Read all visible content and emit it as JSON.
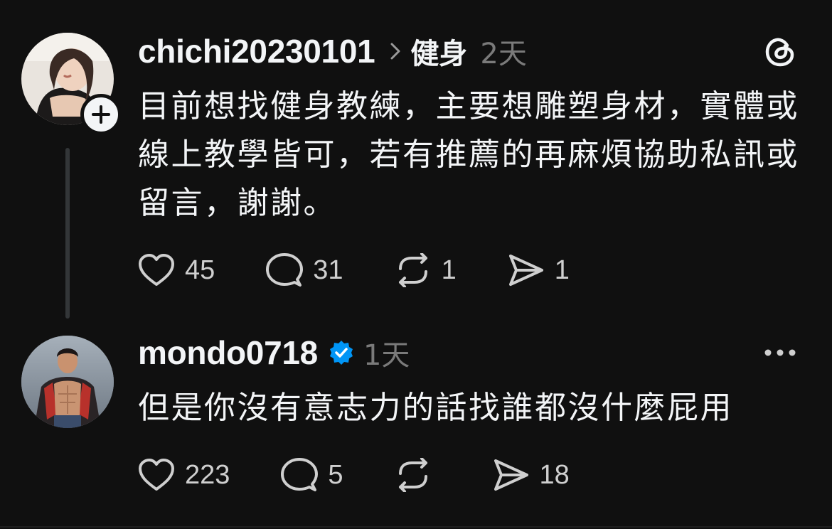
{
  "posts": [
    {
      "username": "chichi20230101",
      "topic": "健身",
      "time": "2天",
      "text": "目前想找健身教練，主要想雕塑身材，實體或線上教學皆可，若有推薦的再麻煩協助私訊或留言，謝謝。",
      "stats": {
        "likes": "45",
        "replies": "31",
        "reposts": "1",
        "shares": "1"
      },
      "avatar_icon": "user-avatar-woman",
      "follow_icon": "plus-icon"
    },
    {
      "username": "mondo0718",
      "verified": true,
      "time": "1天",
      "text": "但是你沒有意志力的話找誰都沒什麼屁用",
      "stats": {
        "likes": "223",
        "replies": "5",
        "reposts": "",
        "shares": "18"
      },
      "avatar_icon": "user-avatar-man"
    }
  ],
  "colors": {
    "background": "#101010",
    "text": "#f3f5f7",
    "muted": "#7a7a7a",
    "verified": "#0095f6"
  },
  "icons": {
    "app_logo": "threads-logo-icon",
    "more": "more-options-icon",
    "like": "heart-icon",
    "reply": "comment-icon",
    "repost": "repost-icon",
    "share": "send-icon"
  }
}
